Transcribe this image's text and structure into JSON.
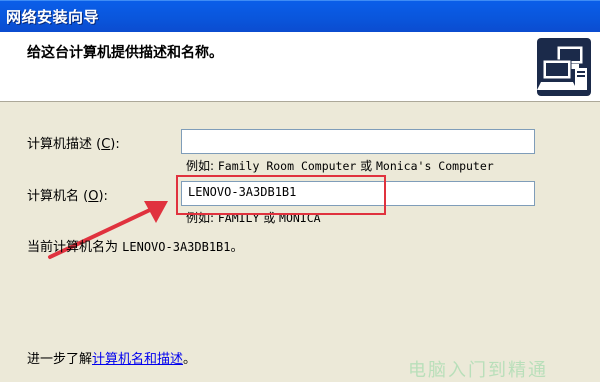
{
  "window": {
    "title": "网络安装向导"
  },
  "header": {
    "title": "给这台计算机提供描述和名称。",
    "icon": "network-computers-icon"
  },
  "form": {
    "description_label_prefix": "计算机描述 (",
    "description_label_key": "C",
    "description_label_suffix": "):",
    "description_value": "",
    "description_example_prefix": "例如: ",
    "description_example_part1": "Family Room Computer",
    "description_example_or": " 或 ",
    "description_example_part2": "Monica's Computer",
    "name_label_prefix": "计算机名 (",
    "name_label_key": "O",
    "name_label_suffix": "):",
    "name_value": "LENOVO-3A3DB1B1",
    "name_example_prefix": "例如: ",
    "name_example_part1": "FAMILY",
    "name_example_or": " 或 ",
    "name_example_part2": "MONICA"
  },
  "current": {
    "prefix": "当前计算机名为 ",
    "name": "LENOVO-3A3DB1B1",
    "suffix": "。"
  },
  "footer": {
    "learn_prefix": "进一步了解",
    "learn_link": "计算机名和描述",
    "learn_suffix": "。"
  },
  "watermark": {
    "text": "电脑入门到精通"
  },
  "colors": {
    "titlebar": "#0a56dc",
    "dialog_bg": "#ece9d8",
    "highlight": "#e0323e",
    "link": "#0000ee"
  }
}
